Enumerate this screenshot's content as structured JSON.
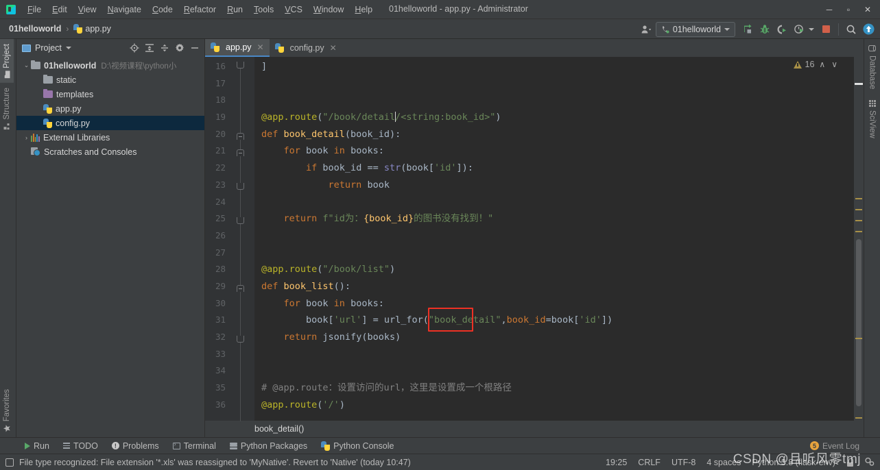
{
  "window": {
    "title": "01helloworld - app.py - Administrator",
    "minimize": "─",
    "maximize": "▫",
    "close": "✕"
  },
  "menu": {
    "items": [
      {
        "label": "File"
      },
      {
        "label": "Edit"
      },
      {
        "label": "View"
      },
      {
        "label": "Navigate"
      },
      {
        "label": "Code"
      },
      {
        "label": "Refactor"
      },
      {
        "label": "Run"
      },
      {
        "label": "Tools"
      },
      {
        "label": "VCS"
      },
      {
        "label": "Window"
      },
      {
        "label": "Help"
      }
    ]
  },
  "navbar": {
    "breadcrumbs": [
      {
        "label": "01helloworld"
      },
      {
        "label": "app.py"
      }
    ],
    "separator": "›",
    "run_config": "01helloworld",
    "icons": [
      {
        "name": "user-settings-icon"
      },
      {
        "name": "run-icon"
      },
      {
        "name": "debug-icon"
      },
      {
        "name": "run-with-coverage-icon"
      },
      {
        "name": "profile-icon"
      },
      {
        "name": "stop-icon"
      },
      {
        "name": "search-everywhere-icon"
      },
      {
        "name": "update-project-icon"
      }
    ]
  },
  "left_strip": {
    "tabs": [
      {
        "label": "Project",
        "active": true
      },
      {
        "label": "Structure",
        "active": false
      },
      {
        "label": "Favorites",
        "active": false
      }
    ]
  },
  "right_strip": {
    "tabs": [
      {
        "label": "Database"
      },
      {
        "label": "SciView"
      }
    ]
  },
  "project_panel": {
    "title": "Project",
    "tools": [
      "locate-icon",
      "expand-all-icon",
      "collapse-all-icon",
      "settings-gear-icon",
      "hide-icon"
    ],
    "tree": [
      {
        "label": "01helloworld",
        "path": "D:\\视频课程\\python小",
        "kind": "root",
        "arrow": "⌄",
        "selected": false
      },
      {
        "label": "static",
        "path": "",
        "kind": "folder",
        "arrow": "",
        "selected": false
      },
      {
        "label": "templates",
        "path": "",
        "kind": "folder-purple",
        "arrow": "",
        "selected": false
      },
      {
        "label": "app.py",
        "path": "",
        "kind": "python",
        "arrow": "",
        "selected": false
      },
      {
        "label": "config.py",
        "path": "",
        "kind": "python",
        "arrow": "",
        "selected": true
      },
      {
        "label": "External Libraries",
        "path": "",
        "kind": "library",
        "arrow": "›",
        "selected": false
      },
      {
        "label": "Scratches and Consoles",
        "path": "",
        "kind": "scratch",
        "arrow": "",
        "selected": false
      }
    ]
  },
  "editor": {
    "tabs": [
      {
        "label": "app.py",
        "active": true,
        "close": "✕"
      },
      {
        "label": "config.py",
        "active": false,
        "close": "✕"
      }
    ],
    "warnings": {
      "count": "16",
      "up": "∧",
      "down": "∨"
    },
    "breadcrumb": "book_detail()",
    "first_line_number": 16,
    "lines": [
      {
        "n": "16",
        "tokens": [
          {
            "t": "]",
            "c": "k-txt"
          }
        ]
      },
      {
        "n": "17",
        "tokens": []
      },
      {
        "n": "18",
        "tokens": []
      },
      {
        "n": "19",
        "tokens": [
          {
            "t": "@app.route",
            "c": "k-dec"
          },
          {
            "t": "(",
            "c": "k-txt"
          },
          {
            "t": "\"/book/detail",
            "c": "k-str"
          },
          {
            "t": "|CARET|",
            "c": "caret"
          },
          {
            "t": "/<string:book_id>\"",
            "c": "k-str"
          },
          {
            "t": ")",
            "c": "k-txt"
          }
        ]
      },
      {
        "n": "20",
        "tokens": [
          {
            "t": "def ",
            "c": "k-kw"
          },
          {
            "t": "book_detail",
            "c": "k-fn"
          },
          {
            "t": "(book_id):",
            "c": "k-txt"
          }
        ]
      },
      {
        "n": "21",
        "tokens": [
          {
            "t": "    ",
            "c": "k-txt"
          },
          {
            "t": "for ",
            "c": "k-kw"
          },
          {
            "t": "book ",
            "c": "k-txt"
          },
          {
            "t": "in ",
            "c": "k-kw"
          },
          {
            "t": "books:",
            "c": "k-txt"
          }
        ]
      },
      {
        "n": "22",
        "tokens": [
          {
            "t": "        ",
            "c": "k-txt"
          },
          {
            "t": "if ",
            "c": "k-kw"
          },
          {
            "t": "book_id == ",
            "c": "k-txt"
          },
          {
            "t": "str",
            "c": "k-builtin"
          },
          {
            "t": "(book[",
            "c": "k-txt"
          },
          {
            "t": "'id'",
            "c": "k-str"
          },
          {
            "t": "]):",
            "c": "k-txt"
          }
        ]
      },
      {
        "n": "23",
        "tokens": [
          {
            "t": "            ",
            "c": "k-txt"
          },
          {
            "t": "return ",
            "c": "k-kw"
          },
          {
            "t": "book",
            "c": "k-txt"
          }
        ]
      },
      {
        "n": "24",
        "tokens": []
      },
      {
        "n": "25",
        "tokens": [
          {
            "t": "    ",
            "c": "k-txt"
          },
          {
            "t": "return ",
            "c": "k-kw"
          },
          {
            "t": "f\"id为：",
            "c": "k-str"
          },
          {
            "t": "{book_id}",
            "c": "k-fn"
          },
          {
            "t": "的图书没有找到！\"",
            "c": "k-str"
          }
        ]
      },
      {
        "n": "26",
        "tokens": []
      },
      {
        "n": "27",
        "tokens": []
      },
      {
        "n": "28",
        "tokens": [
          {
            "t": "@app.route",
            "c": "k-dec"
          },
          {
            "t": "(",
            "c": "k-txt"
          },
          {
            "t": "\"/book/list\"",
            "c": "k-str"
          },
          {
            "t": ")",
            "c": "k-txt"
          }
        ]
      },
      {
        "n": "29",
        "tokens": [
          {
            "t": "def ",
            "c": "k-kw"
          },
          {
            "t": "book_list",
            "c": "k-fn"
          },
          {
            "t": "():",
            "c": "k-txt"
          }
        ]
      },
      {
        "n": "30",
        "tokens": [
          {
            "t": "    ",
            "c": "k-txt"
          },
          {
            "t": "for ",
            "c": "k-kw"
          },
          {
            "t": "book ",
            "c": "k-txt"
          },
          {
            "t": "in ",
            "c": "k-kw"
          },
          {
            "t": "books:",
            "c": "k-txt"
          }
        ]
      },
      {
        "n": "31",
        "tokens": [
          {
            "t": "        book[",
            "c": "k-txt"
          },
          {
            "t": "'url'",
            "c": "k-str"
          },
          {
            "t": "] = url_for(",
            "c": "k-txt"
          },
          {
            "t": "\"book_detail\"",
            "c": "k-str"
          },
          {
            "t": ",",
            "c": "k-txt"
          },
          {
            "t": "book_id",
            "c": "k-param"
          },
          {
            "t": "=book[",
            "c": "k-txt"
          },
          {
            "t": "'id'",
            "c": "k-str"
          },
          {
            "t": "])",
            "c": "k-txt"
          }
        ]
      },
      {
        "n": "32",
        "tokens": [
          {
            "t": "    ",
            "c": "k-txt"
          },
          {
            "t": "return ",
            "c": "k-kw"
          },
          {
            "t": "jsonify(books)",
            "c": "k-txt"
          }
        ]
      },
      {
        "n": "33",
        "tokens": []
      },
      {
        "n": "34",
        "tokens": []
      },
      {
        "n": "35",
        "tokens": [
          {
            "t": "# @app.route：设置访问的url，这里是设置成一个根路径",
            "c": "k-com"
          }
        ]
      },
      {
        "n": "36",
        "tokens": [
          {
            "t": "@app.route",
            "c": "k-dec"
          },
          {
            "t": "(",
            "c": "k-txt"
          },
          {
            "t": "'/'",
            "c": "k-str"
          },
          {
            "t": ")",
            "c": "k-txt"
          }
        ]
      }
    ],
    "annotation": {
      "label": "url_for-highlight",
      "color": "#ee3124"
    }
  },
  "bottom_bar": {
    "items": [
      {
        "label": "Run",
        "icon": "run-icon"
      },
      {
        "label": "TODO",
        "icon": "todo-icon"
      },
      {
        "label": "Problems",
        "icon": "problems-icon"
      },
      {
        "label": "Terminal",
        "icon": "terminal-icon"
      },
      {
        "label": "Python Packages",
        "icon": "packages-icon"
      },
      {
        "label": "Python Console",
        "icon": "python-console-icon"
      }
    ],
    "event_log": {
      "label": "Event Log",
      "count": "5"
    }
  },
  "status_bar": {
    "message": "File type recognized: File extension '*.xls' was reassigned to 'MyNative'. Revert to 'Native' (today 10:47)",
    "right": [
      {
        "label": "19:25",
        "name": "caret-position"
      },
      {
        "label": "CRLF",
        "name": "line-separator"
      },
      {
        "label": "UTF-8",
        "name": "file-encoding"
      },
      {
        "label": "4 spaces",
        "name": "indent-setting"
      },
      {
        "label": "Python 3.8 (flask-env)",
        "name": "python-interpreter"
      }
    ]
  },
  "watermark": "CSDN @且听风零tmj",
  "colors": {
    "accent_blue": "#4a88c7",
    "selection": "#0d293e",
    "editor_bg": "#2b2b2b",
    "panel_bg": "#3c3f41",
    "annotation_red": "#ee3124",
    "warning_yellow": "#a89047"
  }
}
